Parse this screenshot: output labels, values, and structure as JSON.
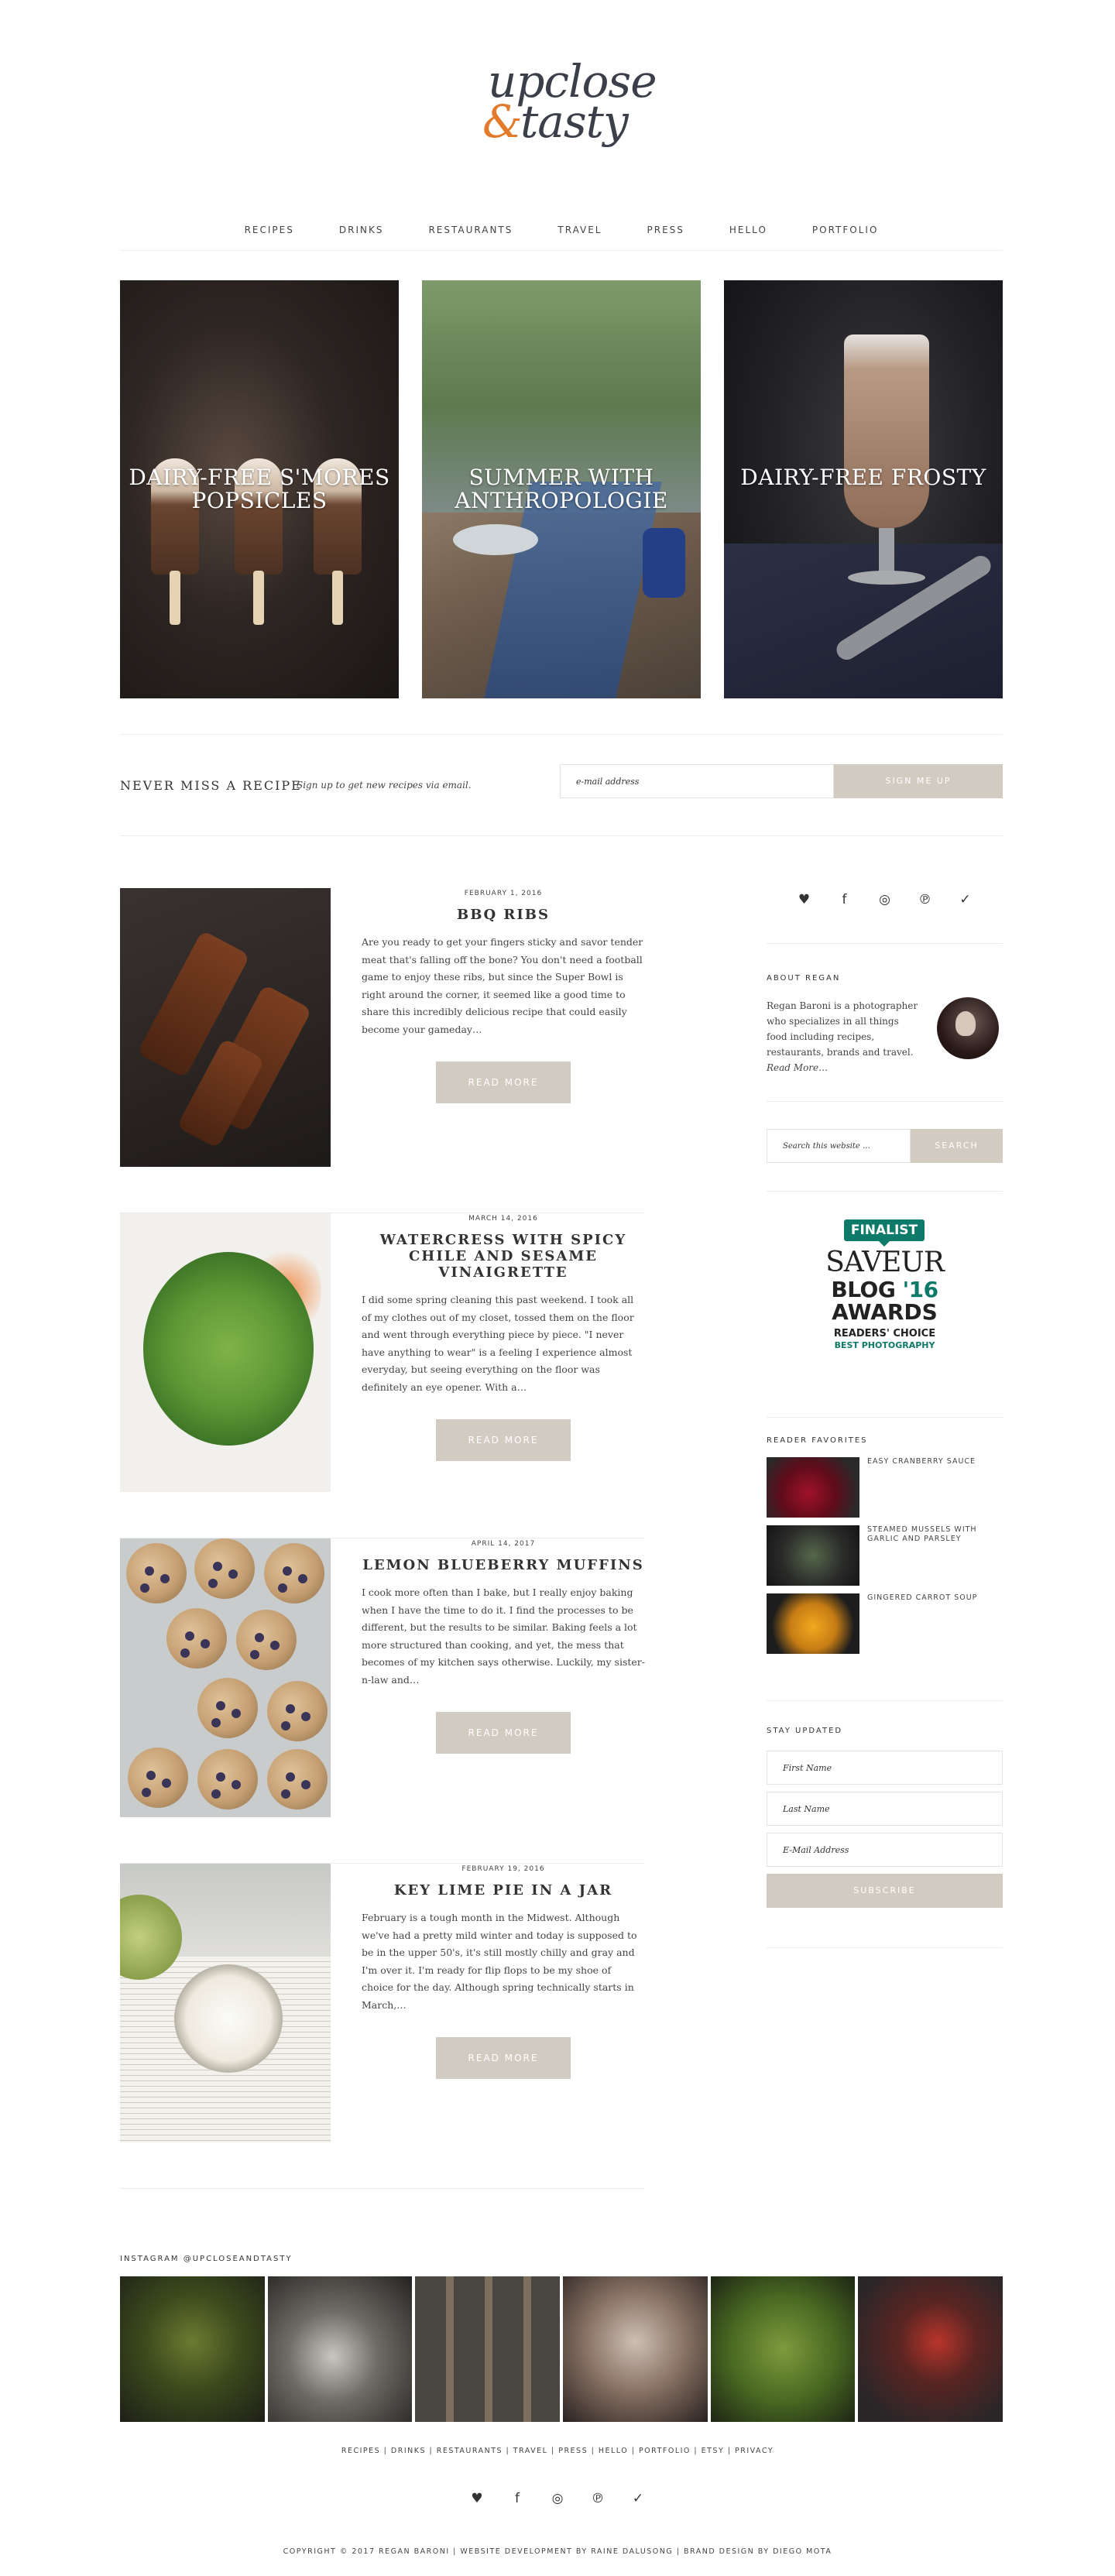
{
  "logo": {
    "line1": "upclose",
    "amp": "&",
    "line2": "tasty"
  },
  "nav": {
    "items": [
      "RECIPES",
      "DRINKS",
      "RESTAURANTS",
      "TRAVEL",
      "PRESS",
      "HELLO",
      "PORTFOLIO"
    ]
  },
  "featured": [
    {
      "title": "DAIRY-FREE S'MORES POPSICLES"
    },
    {
      "title": "SUMMER WITH ANTHROPOLOGIE"
    },
    {
      "title": "DAIRY-FREE FROSTY"
    }
  ],
  "signup": {
    "heading": "NEVER MISS A RECIPE",
    "sub": "Sign up to get new recipes via email.",
    "placeholder": "e-mail address",
    "button": "SIGN ME UP"
  },
  "posts": [
    {
      "date": "FEBRUARY 1, 2016",
      "title": "BBQ RIBS",
      "excerpt": "Are you ready to get your fingers sticky and savor tender meat that's falling off the bone? You don't need a football game to enjoy these ribs, but since the Super Bowl is right around the corner, it seemed like a good time to share this incredibly delicious recipe that could easily become your gameday…",
      "more": "READ MORE"
    },
    {
      "date": "MARCH 14, 2016",
      "title": "WATERCRESS WITH SPICY CHILE AND SESAME VINAIGRETTE",
      "excerpt": "I did some spring cleaning this past weekend. I took all of my clothes out of my closet, tossed them on the floor and went through everything piece by piece. \"I never have anything to wear\" is a feeling I experience almost everyday, but seeing everything on the floor was definitely an eye opener. With a…",
      "more": "READ MORE"
    },
    {
      "date": "APRIL 14, 2017",
      "title": "LEMON BLUEBERRY MUFFINS",
      "excerpt": "I cook more often than I bake, but I really enjoy baking when I have the time to do it. I find the processes to be different, but the results to be similar. Baking feels a lot more structured than cooking, and yet, the mess that becomes of my kitchen says otherwise. Luckily, my sister-n-law and…",
      "more": "READ MORE"
    },
    {
      "date": "FEBRUARY 19, 2016",
      "title": "KEY LIME PIE IN A JAR",
      "excerpt": "February is a tough month in the Midwest. Although we've had a pretty mild winter and today is supposed to be in the upper 50's, it's still mostly chilly and gray and I'm over it. I'm ready for flip flops to be my shoe of choice for the day. Although spring technically starts in March,…",
      "more": "READ MORE"
    }
  ],
  "social": {
    "icons": [
      "heart-icon",
      "facebook-icon",
      "instagram-icon",
      "pinterest-icon",
      "twitter-icon"
    ],
    "glyphs": [
      "♥",
      "f",
      "◎",
      "℗",
      "✓"
    ]
  },
  "about": {
    "heading": "ABOUT REGAN",
    "text": "Regan Baroni is a photographer who specializes in all things food including recipes, restaurants, brands and travel.",
    "more": "Read More…"
  },
  "search": {
    "placeholder": "Search this website …",
    "button": "SEARCH"
  },
  "award": {
    "badge": "FINALIST",
    "saveur": "SAVEUR",
    "blog": "BLOG",
    "year": "'16",
    "awards": "AWARDS",
    "readers_choice": "READERS' CHOICE",
    "category": "BEST PHOTOGRAPHY"
  },
  "favorites": {
    "heading": "READER FAVORITES",
    "items": [
      "EASY CRANBERRY SAUCE",
      "STEAMED MUSSELS WITH GARLIC AND PARSLEY",
      "GINGERED CARROT SOUP"
    ]
  },
  "stay": {
    "heading": "STAY UPDATED",
    "first": "First Name",
    "last": "Last Name",
    "email": "E-Mail Address",
    "button": "SUBSCRIBE"
  },
  "instagram": {
    "heading": "INSTAGRAM @UPCLOSEANDTASTY"
  },
  "footer": {
    "nav": "RECIPES | DRINKS | RESTAURANTS | TRAVEL | PRESS | HELLO | PORTFOLIO | ETSY | PRIVACY",
    "copyright": "COPYRIGHT © 2017 REGAN BARONI | WEBSITE DEVELOPMENT BY RAINE DALUSONG | BRAND DESIGN BY DIEGO MOTA"
  },
  "colors": {
    "accent": "#e27b2c",
    "button": "#d2cbc2",
    "brand_text": "#3a3f4a",
    "saveur_teal": "#0e7a6a"
  }
}
